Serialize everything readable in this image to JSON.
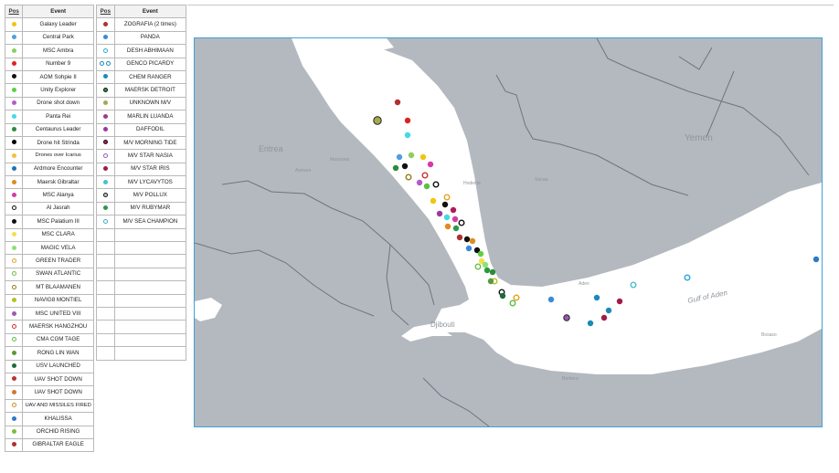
{
  "legend_left": {
    "header_pos": "Pos",
    "header_event": "Event",
    "rows": [
      {
        "event": "Galaxy Leader",
        "color": "#f2c40f",
        "style": "dot"
      },
      {
        "event": "Central Park",
        "color": "#4f9fe0",
        "style": "dot"
      },
      {
        "event": "MSC Ambra",
        "color": "#8fce5a",
        "style": "dot"
      },
      {
        "event": "Number 9",
        "color": "#e02020",
        "style": "dot"
      },
      {
        "event": "AOM Sohpie II",
        "color": "#111111",
        "style": "dot"
      },
      {
        "event": "Unity Explorer",
        "color": "#5fd040",
        "style": "dot"
      },
      {
        "event": "Drone shot down",
        "color": "#b45cc8",
        "style": "dot"
      },
      {
        "event": "Panta Rei",
        "color": "#43d9e8",
        "style": "dot"
      },
      {
        "event": "Centaurus Leader",
        "color": "#2e8b3a",
        "style": "dot"
      },
      {
        "event": "Drone hit Strinda",
        "color": "#000000",
        "style": "dot"
      },
      {
        "event": "Drones over Icarius",
        "color": "#f0c040",
        "style": "dot"
      },
      {
        "event": "Ardmore Encounter",
        "color": "#1e72b8",
        "style": "dot"
      },
      {
        "event": "Maersk Gibraltar",
        "color": "#e08a20",
        "style": "dot"
      },
      {
        "event": "MSC Alanya",
        "color": "#d63aa8",
        "style": "dot"
      },
      {
        "event": "Al Jasrah",
        "color": "#111111",
        "style": "ring"
      },
      {
        "event": "MSC Palatium III",
        "color": "#111111",
        "style": "dot"
      },
      {
        "event": "MSC CLARA",
        "color": "#f4e04a",
        "style": "dot"
      },
      {
        "event": "MAGIC VELA",
        "color": "#8ee07a",
        "style": "dot"
      },
      {
        "event": "GREEN TRADER",
        "color": "#e8a020",
        "style": "ring"
      },
      {
        "event": "SWAN ATLANTIC",
        "color": "#6cc04a",
        "style": "ring"
      },
      {
        "event": "MT BLAAMANEN",
        "color": "#9a7a1a",
        "style": "ring"
      },
      {
        "event": "NAVIG8 MONTIEL",
        "color": "#b8c020",
        "style": "dot"
      },
      {
        "event": "MSC UNITED VIII",
        "color": "#9a5ab0",
        "style": "dot"
      },
      {
        "event": "MAERSK HANGZHOU",
        "color": "#d03030",
        "style": "ring"
      },
      {
        "event": "CMA CGM TAGE",
        "color": "#5ac040",
        "style": "ring"
      },
      {
        "event": "RONG LIN WAN",
        "color": "#5a9a3a",
        "style": "dot"
      },
      {
        "event": "USV LAUNCHED",
        "color": "#1f6a3a",
        "style": "dot"
      },
      {
        "event": "UAV SHOT DOWN",
        "color": "#c03030",
        "style": "dot"
      },
      {
        "event": "UAV SHOT DOWN",
        "color": "#d07a30",
        "style": "dot"
      },
      {
        "event": "UAV AND MISSILES FIRED",
        "color": "#c89020",
        "style": "ring"
      },
      {
        "event": "KHALISSA",
        "color": "#2a7ac8",
        "style": "dot"
      },
      {
        "event": "ORCHID RISING",
        "color": "#7ac040",
        "style": "dot"
      },
      {
        "event": "GIBRALTAR EAGLE",
        "color": "#b03030",
        "style": "dot"
      }
    ]
  },
  "legend_right": {
    "header_pos": "Pos",
    "header_event": "Event",
    "rows": [
      {
        "event": "ZOGRAFIA (2 times)",
        "color": "#b03030",
        "style": "dot"
      },
      {
        "event": "PANDA",
        "color": "#3a8ad8",
        "style": "dot"
      },
      {
        "event": "DESH ABHIMAAN",
        "color": "#2aa8d8",
        "style": "ring"
      },
      {
        "event": "GENCO PICARDY",
        "color": "#1a8ab8",
        "style": "pair"
      },
      {
        "event": "CHEM RANGER",
        "color": "#1a8ab8",
        "style": "dot"
      },
      {
        "event": "MAERSK DETROIT",
        "color": "#2a9a3a",
        "style": "ring-dark"
      },
      {
        "event": "UNKNOWN M/V",
        "color": "#a8a850",
        "style": "dot"
      },
      {
        "event": "MARLIN LUANDA",
        "color": "#a03a8a",
        "style": "dot"
      },
      {
        "event": "DAFFODIL",
        "color": "#9a3aa0",
        "style": "dot"
      },
      {
        "event": "M/V MORNING TIDE",
        "color": "#b01a5a",
        "style": "ring-dark"
      },
      {
        "event": "M/V STAR NASIA",
        "color": "#9a5ab0",
        "style": "ring"
      },
      {
        "event": "M/V STAR IRIS",
        "color": "#a01a4a",
        "style": "dot"
      },
      {
        "event": "M/V LYCAVYTOS",
        "color": "#4ac0c8",
        "style": "dot"
      },
      {
        "event": "M/V POLLUX",
        "color": "#c8c8c8",
        "style": "ring-dark"
      },
      {
        "event": "M/V RUBYMAR",
        "color": "#2a9a4a",
        "style": "dot"
      },
      {
        "event": "M/V SEA CHAMPION",
        "color": "#3ab0b8",
        "style": "ring"
      }
    ],
    "empty_rows": 10
  },
  "map": {
    "labels": {
      "eritrea": "Eritrea",
      "yemen": "Yemen",
      "djibouti": "Djibouti",
      "gulf_of_aden": "Gulf of Aden",
      "aden": "Aden",
      "asmara": "Asmara",
      "massawa": "Massawa",
      "hodeidah": "Hodeida",
      "berbera": "Berbera",
      "bosaso": "Bosaso",
      "sanaa": "Sanaa"
    }
  },
  "markers": [
    {
      "color": "#a8a850",
      "style": "ring-dark"
    },
    {
      "color": "#b03030",
      "style": "dot"
    },
    {
      "color": "#e02020",
      "style": "dot"
    },
    {
      "color": "#43d9e8",
      "style": "dot"
    },
    {
      "color": "#8fce5a",
      "style": "dot"
    },
    {
      "color": "#f2c40f",
      "style": "dot"
    },
    {
      "color": "#4f9fe0",
      "style": "dot"
    },
    {
      "color": "#111111",
      "style": "dot"
    },
    {
      "color": "#2e8b3a",
      "style": "dot"
    },
    {
      "color": "#d63aa8",
      "style": "dot"
    },
    {
      "color": "#d03030",
      "style": "ring"
    },
    {
      "color": "#9a7a1a",
      "style": "ring"
    },
    {
      "color": "#b45cc8",
      "style": "dot"
    },
    {
      "color": "#5ac040",
      "style": "dot"
    },
    {
      "color": "#111111",
      "style": "ring"
    },
    {
      "color": "#e8a020",
      "style": "ring"
    },
    {
      "color": "#f2c40f",
      "style": "dot"
    },
    {
      "color": "#111111",
      "style": "dot"
    },
    {
      "color": "#9a3aa0",
      "style": "dot"
    },
    {
      "color": "#b01a5a",
      "style": "dot"
    },
    {
      "color": "#43d9e8",
      "style": "dot"
    },
    {
      "color": "#d63aa8",
      "style": "dot"
    },
    {
      "color": "#e08a20",
      "style": "dot"
    },
    {
      "color": "#111111",
      "style": "ring"
    },
    {
      "color": "#2a9a4a",
      "style": "dot"
    },
    {
      "color": "#b03030",
      "style": "dot"
    },
    {
      "color": "#111111",
      "style": "dot"
    },
    {
      "color": "#3a8ad8",
      "style": "dot"
    },
    {
      "color": "#e08a20",
      "style": "dot"
    },
    {
      "color": "#111111",
      "style": "dot"
    },
    {
      "color": "#5fd040",
      "style": "dot"
    },
    {
      "color": "#f4e04a",
      "style": "dot"
    },
    {
      "color": "#8ee07a",
      "style": "dot"
    },
    {
      "color": "#6cc04a",
      "style": "ring"
    },
    {
      "color": "#2a9a3a",
      "style": "dot"
    },
    {
      "color": "#2e8b3a",
      "style": "dot"
    },
    {
      "color": "#b8c020",
      "style": "ring"
    },
    {
      "color": "#5a9a3a",
      "style": "dot"
    },
    {
      "color": "#111111",
      "style": "ring"
    },
    {
      "color": "#1f6a3a",
      "style": "dot"
    },
    {
      "color": "#e8a020",
      "style": "ring"
    },
    {
      "color": "#5ac040",
      "style": "ring"
    },
    {
      "color": "#3a8ad8",
      "style": "dot"
    },
    {
      "color": "#1a8ab8",
      "style": "dot"
    },
    {
      "color": "#a01a4a",
      "style": "dot"
    },
    {
      "color": "#9a5ab0",
      "style": "ring-dark"
    },
    {
      "color": "#1a8ab8",
      "style": "dot"
    },
    {
      "color": "#a01a4a",
      "style": "dot"
    },
    {
      "color": "#4ac0c8",
      "style": "ring"
    },
    {
      "color": "#2aa8d8",
      "style": "ring"
    },
    {
      "color": "#1a8ab8",
      "style": "dot"
    },
    {
      "color": "#2a7ac8",
      "style": "dot"
    }
  ]
}
